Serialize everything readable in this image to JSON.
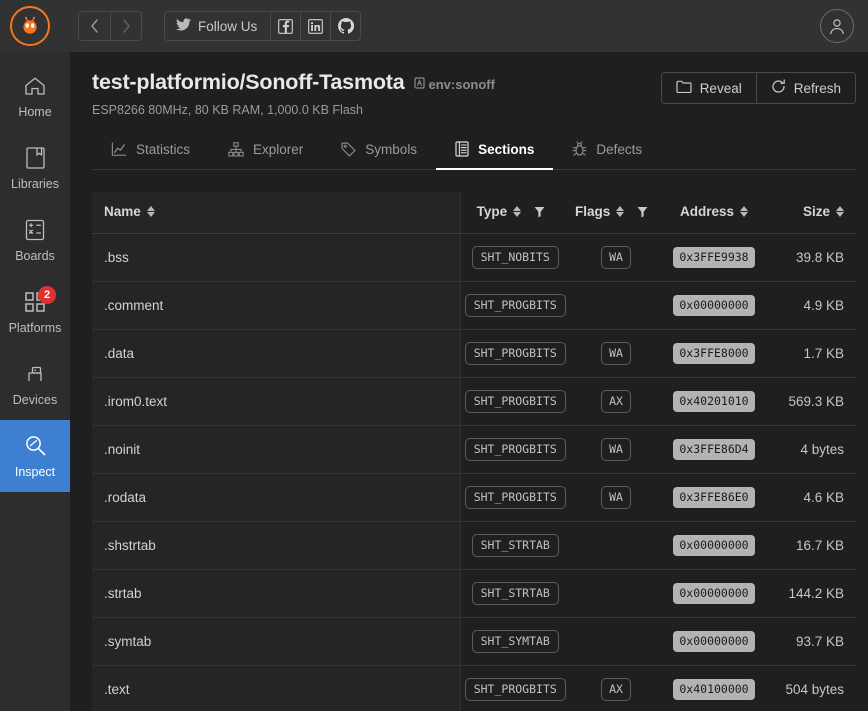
{
  "topbar": {
    "logo_icon": "platformio-ant-logo",
    "back_label": "‹",
    "forward_label": "›",
    "follow_label": "Follow Us",
    "twitter_icon": "twitter-icon",
    "facebook_icon": "facebook-icon",
    "linkedin_icon": "linkedin-icon",
    "github_icon": "github-icon",
    "avatar_icon": "account-avatar-icon"
  },
  "sidebar": {
    "items": [
      {
        "label": "Home",
        "icon": "home-icon"
      },
      {
        "label": "Libraries",
        "icon": "book-icon"
      },
      {
        "label": "Boards",
        "icon": "calculator-icon"
      },
      {
        "label": "Platforms",
        "icon": "grid-squares-icon",
        "badge": "2"
      },
      {
        "label": "Devices",
        "icon": "usb-device-icon"
      },
      {
        "label": "Inspect",
        "icon": "magnifier-icon",
        "active": true
      }
    ]
  },
  "header": {
    "title": "test-platformio/Sonoff-Tasmota",
    "env": "env:sonoff",
    "env_icon": "environment-icon",
    "subtitle": "ESP8266 80MHz, 80 KB RAM, 1,000.0 KB Flash",
    "reveal_label": "Reveal",
    "reveal_icon": "folder-icon",
    "refresh_label": "Refresh",
    "refresh_icon": "refresh-icon"
  },
  "tabs": [
    {
      "label": "Statistics",
      "icon": "chart-line-icon",
      "active": false
    },
    {
      "label": "Explorer",
      "icon": "sitemap-icon",
      "active": false
    },
    {
      "label": "Symbols",
      "icon": "tag-icon",
      "active": false
    },
    {
      "label": "Sections",
      "icon": "list-table-icon",
      "active": true
    },
    {
      "label": "Defects",
      "icon": "bug-icon",
      "active": false
    }
  ],
  "table": {
    "columns": [
      {
        "key": "name",
        "label": "Name",
        "sortable": true,
        "filter": false
      },
      {
        "key": "type",
        "label": "Type",
        "sortable": true,
        "filter": true
      },
      {
        "key": "flags",
        "label": "Flags",
        "sortable": true,
        "filter": true
      },
      {
        "key": "address",
        "label": "Address",
        "sortable": true,
        "filter": false
      },
      {
        "key": "size",
        "label": "Size",
        "sortable": true,
        "filter": false
      }
    ],
    "sort_icon": "sort-updown-icon",
    "filter_icon": "funnel-filter-icon",
    "rows": [
      {
        "name": ".bss",
        "type": "SHT_NOBITS",
        "flags": "WA",
        "address": "0x3FFE9938",
        "size": "39.8 KB"
      },
      {
        "name": ".comment",
        "type": "SHT_PROGBITS",
        "flags": "",
        "address": "0x00000000",
        "size": "4.9 KB"
      },
      {
        "name": ".data",
        "type": "SHT_PROGBITS",
        "flags": "WA",
        "address": "0x3FFE8000",
        "size": "1.7 KB"
      },
      {
        "name": ".irom0.text",
        "type": "SHT_PROGBITS",
        "flags": "AX",
        "address": "0x40201010",
        "size": "569.3 KB"
      },
      {
        "name": ".noinit",
        "type": "SHT_PROGBITS",
        "flags": "WA",
        "address": "0x3FFE86D4",
        "size": "4 bytes"
      },
      {
        "name": ".rodata",
        "type": "SHT_PROGBITS",
        "flags": "WA",
        "address": "0x3FFE86E0",
        "size": "4.6 KB"
      },
      {
        "name": ".shstrtab",
        "type": "SHT_STRTAB",
        "flags": "",
        "address": "0x00000000",
        "size": "16.7 KB"
      },
      {
        "name": ".strtab",
        "type": "SHT_STRTAB",
        "flags": "",
        "address": "0x00000000",
        "size": "144.2 KB"
      },
      {
        "name": ".symtab",
        "type": "SHT_SYMTAB",
        "flags": "",
        "address": "0x00000000",
        "size": "93.7 KB"
      },
      {
        "name": ".text",
        "type": "SHT_PROGBITS",
        "flags": "AX",
        "address": "0x40100000",
        "size": "504 bytes"
      }
    ]
  },
  "colors": {
    "accent_blue": "#3d7fd0",
    "brand_orange": "#f47721",
    "badge_red": "#e03131",
    "bg_main": "#1f1f20",
    "bg_sidebar": "#2d2d2e",
    "bg_topbar": "#323233",
    "bg_pinned_col": "#252526"
  }
}
